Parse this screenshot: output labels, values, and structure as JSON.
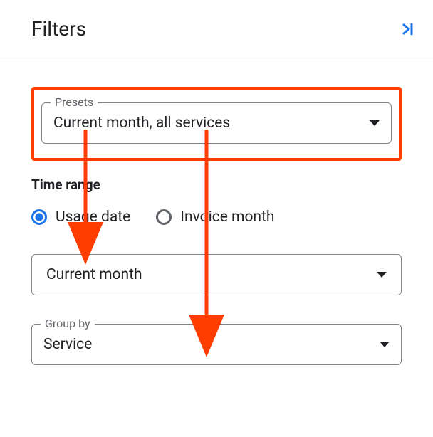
{
  "header": {
    "title": "Filters"
  },
  "presets": {
    "label": "Presets",
    "value": "Current month, all services"
  },
  "timeRange": {
    "sectionLabel": "Time range",
    "options": {
      "usageDate": "Usage date",
      "invoiceMonth": "Invoice month"
    },
    "dropdownValue": "Current month"
  },
  "groupBy": {
    "label": "Group by",
    "value": "Service"
  }
}
